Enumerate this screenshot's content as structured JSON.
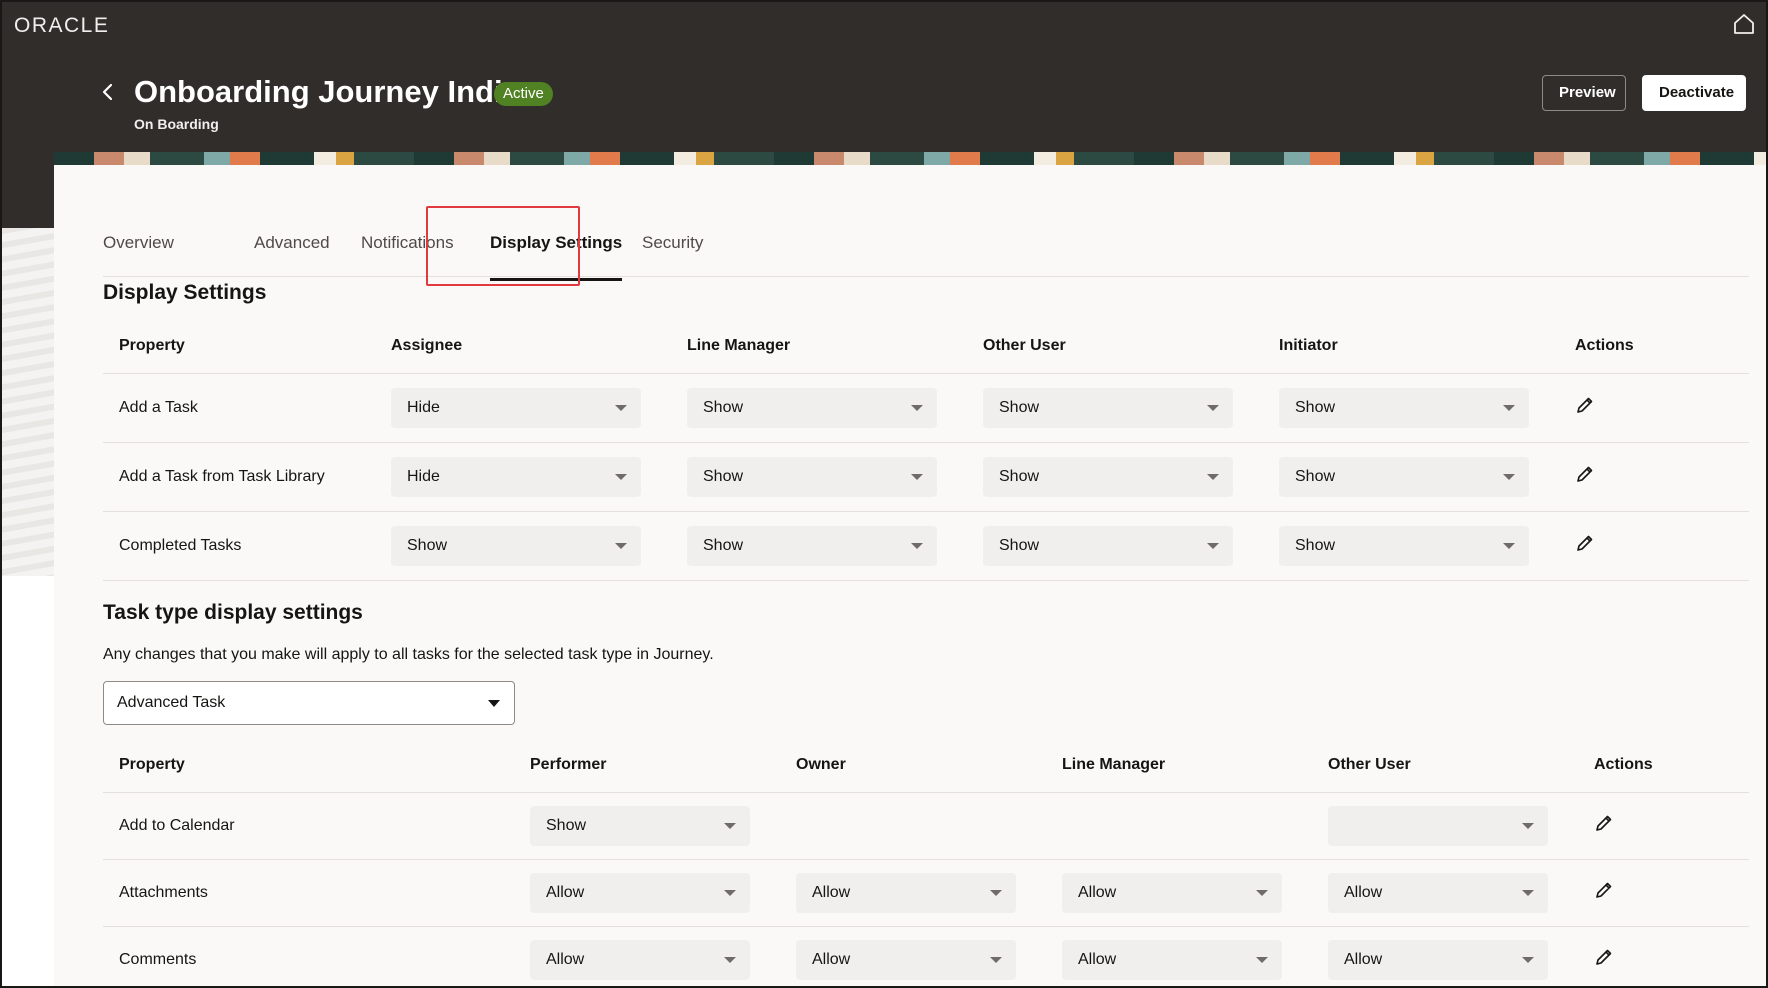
{
  "header": {
    "logo": "ORACLE",
    "title": "Onboarding Journey India",
    "status": "Active",
    "subtitle": "On Boarding",
    "preview_label": "Preview",
    "deactivate_label": "Deactivate"
  },
  "colors": {
    "header_bg": "#312d2a",
    "badge_green": "#508223",
    "highlight_red": "#e0393e"
  },
  "tabs": [
    {
      "label": "Overview",
      "active": false
    },
    {
      "label": "Advanced",
      "active": false
    },
    {
      "label": "Notifications",
      "active": false
    },
    {
      "label": "Display Settings",
      "active": true
    },
    {
      "label": "Security",
      "active": false
    }
  ],
  "display_settings": {
    "title": "Display Settings",
    "columns": [
      "Property",
      "Assignee",
      "Line Manager",
      "Other User",
      "Initiator",
      "Actions"
    ],
    "rows": [
      {
        "property": "Add a Task",
        "values": [
          "Hide",
          "Show",
          "Show",
          "Show"
        ]
      },
      {
        "property": "Add a Task from Task Library",
        "values": [
          "Hide",
          "Show",
          "Show",
          "Show"
        ]
      },
      {
        "property": "Completed Tasks",
        "values": [
          "Show",
          "Show",
          "Show",
          "Show"
        ]
      }
    ]
  },
  "task_type": {
    "title": "Task type display settings",
    "hint": "Any changes that you make will apply to all tasks for the selected task type in Journey.",
    "selected": "Advanced Task",
    "columns": [
      "Property",
      "Performer",
      "Owner",
      "Line Manager",
      "Other User",
      "Actions"
    ],
    "rows": [
      {
        "property": "Add to Calendar",
        "values": [
          "Show",
          null,
          null,
          ""
        ]
      },
      {
        "property": "Attachments",
        "values": [
          "Allow",
          "Allow",
          "Allow",
          "Allow"
        ]
      },
      {
        "property": "Comments",
        "values": [
          "Allow",
          "Allow",
          "Allow",
          "Allow"
        ]
      }
    ]
  },
  "icons": [
    "home-icon",
    "back-icon",
    "edit-icon",
    "chevron-down-icon"
  ]
}
